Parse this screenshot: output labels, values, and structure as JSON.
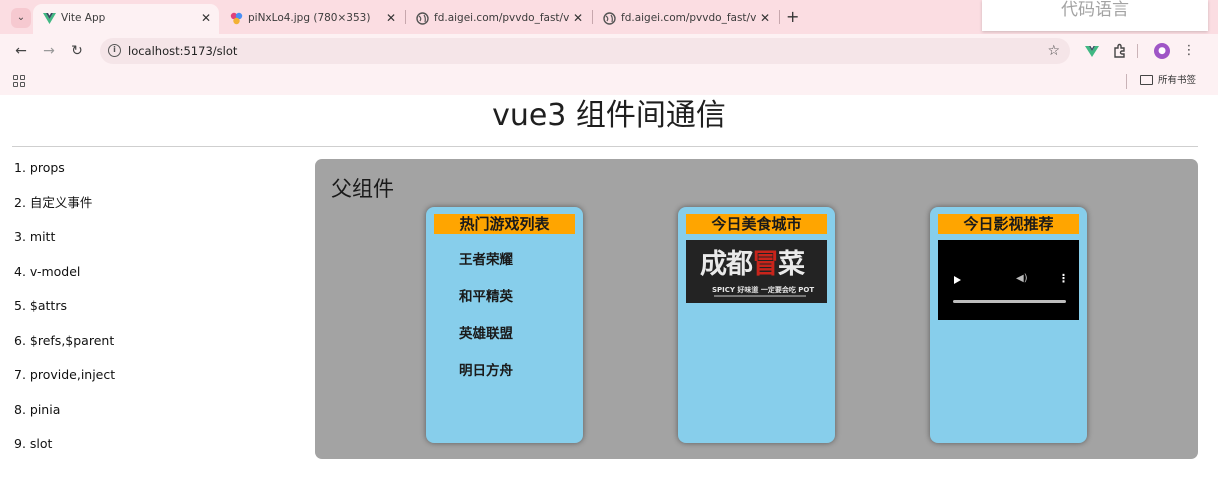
{
  "browser": {
    "tabs": [
      {
        "title": "Vite App",
        "active": true
      },
      {
        "title": "piNxLo4.jpg (780×353)",
        "active": false
      },
      {
        "title": "fd.aigei.com/pvvdo_fast/vdo",
        "active": false
      },
      {
        "title": "fd.aigei.com/pvvdo_fast/vdo",
        "active": false
      }
    ],
    "overlay_text": "代码语言",
    "address": "localhost:5173/slot",
    "bookmarks_folder": "所有书签",
    "accent_color": "#fbdde2"
  },
  "page": {
    "title": "vue3 组件间通信",
    "nav": [
      "1. props",
      "2. 自定义事件",
      "3. mitt",
      "4. v-model",
      "5. $attrs",
      "6. $refs,$parent",
      "7. provide,inject",
      "8. pinia",
      "9. slot"
    ],
    "parent_title": "父组件",
    "cards": {
      "games": {
        "title": "热门游戏列表",
        "items": [
          "王者荣耀",
          "和平精英",
          "英雄联盟",
          "明日方舟"
        ]
      },
      "food": {
        "title": "今日美食城市",
        "image_text_big": "成都冒菜",
        "image_text_small": "SPICY 好味道 一定要会吃 POT"
      },
      "movies": {
        "title": "今日影视推荐"
      }
    },
    "colors": {
      "parent_bg": "#a3a3a3",
      "card_bg": "#87ceeb",
      "card_header": "#ffa500"
    }
  }
}
